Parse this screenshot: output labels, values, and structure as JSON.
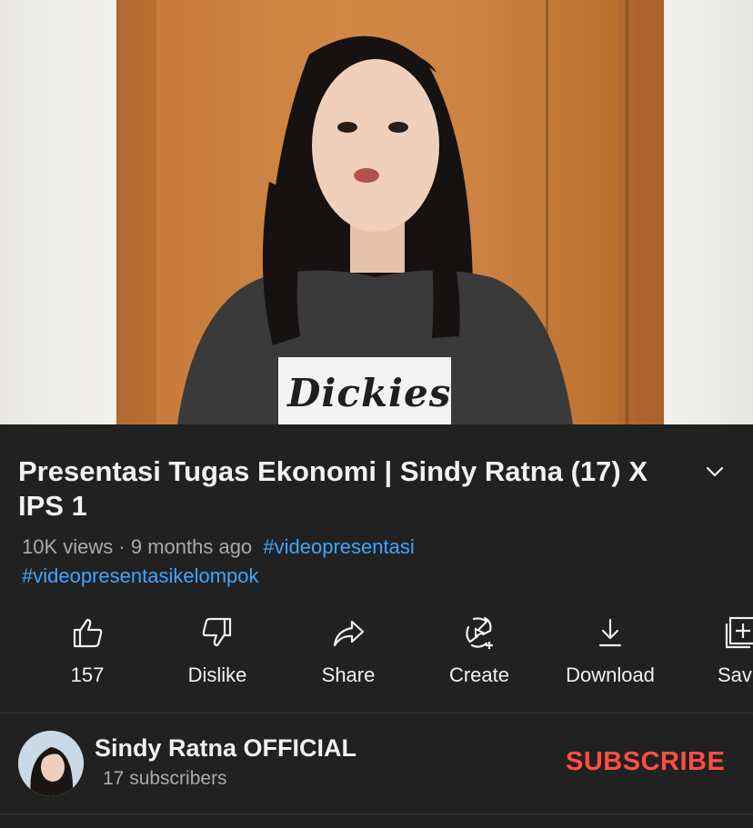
{
  "video": {
    "shirt_text": "Dickies"
  },
  "title": "Presentasi Tugas Ekonomi | Sindy Ratna (17) X IPS 1",
  "meta": {
    "views": "10K views",
    "separator": "·",
    "age": "9 months ago",
    "hashtags": [
      "#videopresentasi",
      "#videopresentasikelompok"
    ]
  },
  "actions": [
    {
      "name": "like",
      "label": "157",
      "icon": "thumbs-up-icon"
    },
    {
      "name": "dislike",
      "label": "Dislike",
      "icon": "thumbs-down-icon"
    },
    {
      "name": "share",
      "label": "Share",
      "icon": "share-arrow-icon"
    },
    {
      "name": "create",
      "label": "Create",
      "icon": "create-sparkle-icon"
    },
    {
      "name": "download",
      "label": "Download",
      "icon": "download-icon"
    },
    {
      "name": "save",
      "label": "Sav",
      "icon": "add-to-playlist-icon"
    }
  ],
  "channel": {
    "name": "Sindy Ratna OFFICIAL",
    "subscribers": "17 subscribers",
    "subscribe_label": "SUBSCRIBE"
  },
  "colors": {
    "background": "#212121",
    "link": "#3ea6ff",
    "subscribe": "#ff4e45",
    "secondary_text": "#aaaaaa"
  }
}
